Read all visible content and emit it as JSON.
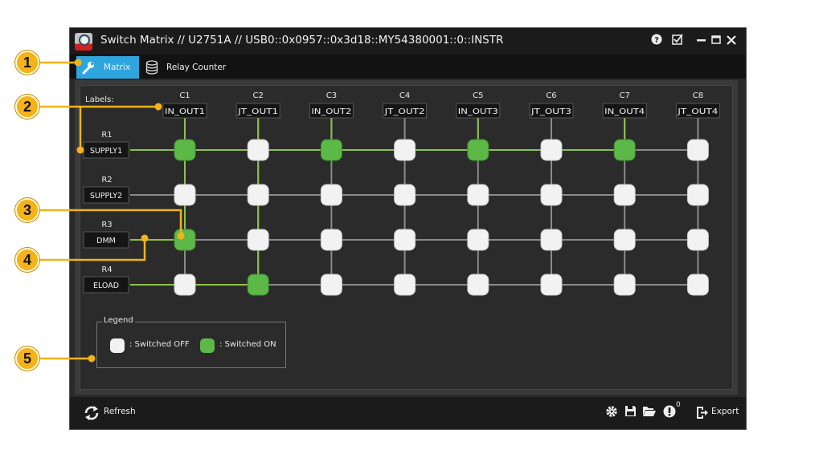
{
  "window": {
    "title": "Switch Matrix // U2751A // USB0::0x0957::0x3d18::MY54380001::0::INSTR"
  },
  "tabs": [
    {
      "label": "Matrix",
      "icon": "wrench-icon",
      "active": true
    },
    {
      "label": "Relay Counter",
      "icon": "database-icon",
      "active": false
    }
  ],
  "matrix": {
    "labels_caption": "Labels:",
    "columns": [
      {
        "id": "C1",
        "label": "IN_OUT1"
      },
      {
        "id": "C2",
        "label": "JT_OUT1"
      },
      {
        "id": "C3",
        "label": "IN_OUT2"
      },
      {
        "id": "C4",
        "label": "JT_OUT2"
      },
      {
        "id": "C5",
        "label": "IN_OUT3"
      },
      {
        "id": "C6",
        "label": "JT_OUT3"
      },
      {
        "id": "C7",
        "label": "IN_OUT4"
      },
      {
        "id": "C8",
        "label": "JT_OUT4"
      }
    ],
    "rows": [
      {
        "id": "R1",
        "label": "SUPPLY1"
      },
      {
        "id": "R2",
        "label": "SUPPLY2"
      },
      {
        "id": "R3",
        "label": "DMM"
      },
      {
        "id": "R4",
        "label": "ELOAD"
      }
    ],
    "states": [
      [
        1,
        0,
        1,
        0,
        1,
        0,
        1,
        0
      ],
      [
        0,
        0,
        0,
        0,
        0,
        0,
        0,
        0
      ],
      [
        1,
        0,
        0,
        0,
        0,
        0,
        0,
        0
      ],
      [
        0,
        1,
        0,
        0,
        0,
        0,
        0,
        0
      ]
    ]
  },
  "legend": {
    "title": "Legend",
    "off_label": ": Switched OFF",
    "on_label": ": Switched ON"
  },
  "bottombar": {
    "refresh_label": "Refresh",
    "alerts_count": "0",
    "export_label": "Export"
  },
  "callouts": [
    "1",
    "2",
    "3",
    "4",
    "5"
  ],
  "colors": {
    "on": "#5cb847",
    "off": "#f2f2f2",
    "active_line": "#8bc34a",
    "inactive_line": "#8a8a8a",
    "accent": "#2fa5dd",
    "callout": "#f3b319"
  }
}
